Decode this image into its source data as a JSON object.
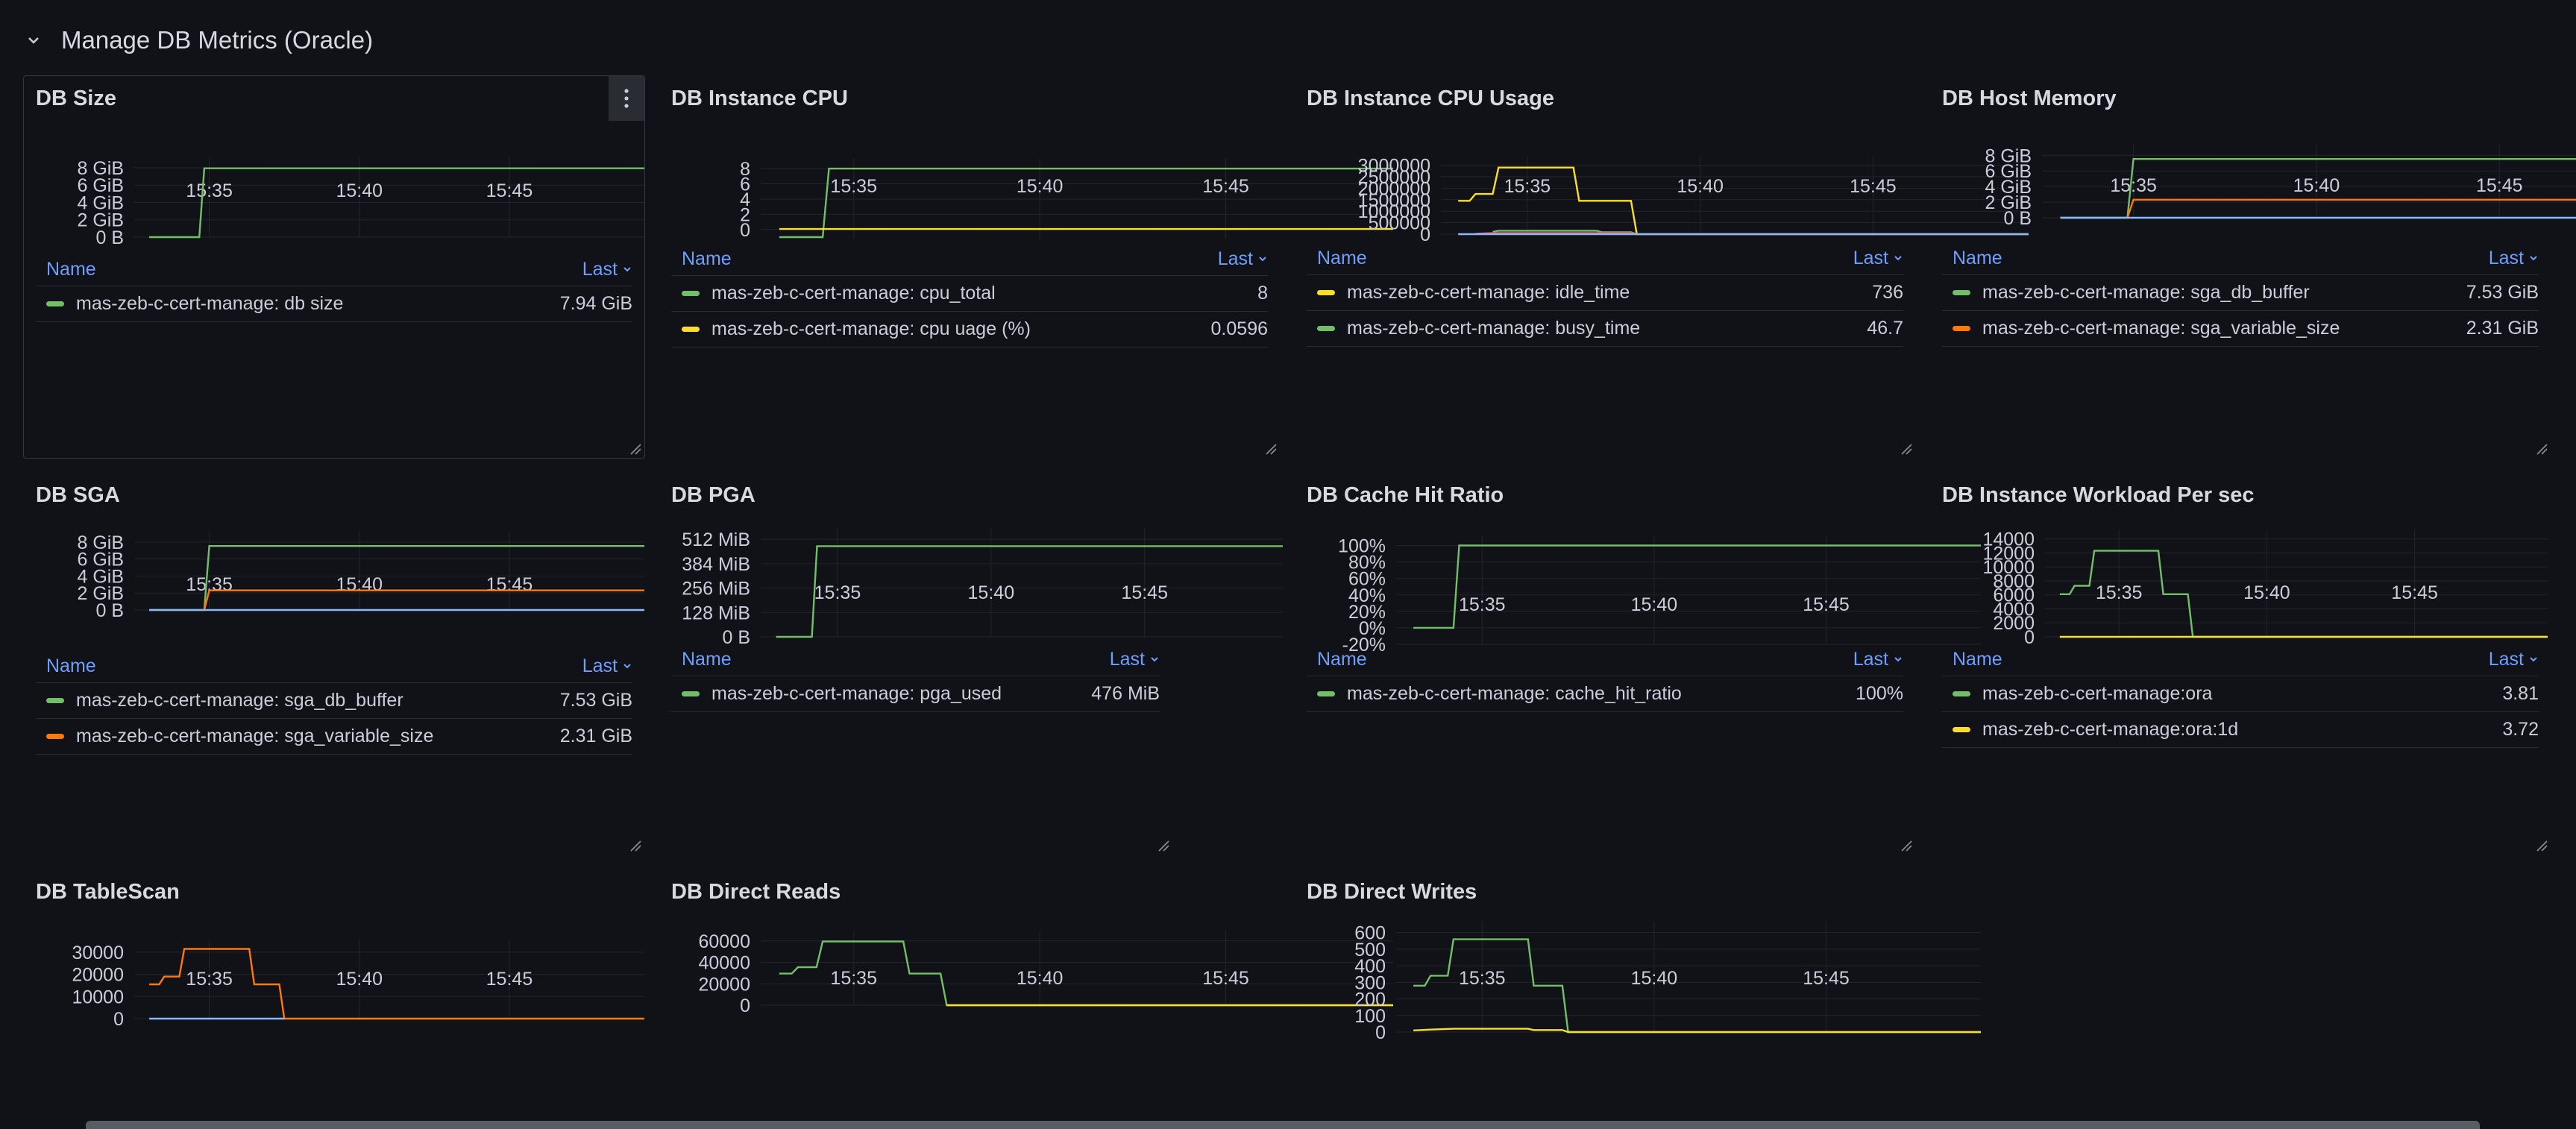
{
  "row": {
    "title": "Manage DB Metrics (Oracle)"
  },
  "colors": {
    "green": "#73bf69",
    "yellow": "#fade2a",
    "orange": "#ff780a",
    "blue": "#8ab8ff",
    "red": "#f2495c",
    "accent": "#6e9fff",
    "background": "#111217"
  },
  "legend_header": {
    "name": "Name",
    "last": "Last"
  },
  "panels": [
    {
      "title": "DB Size",
      "legend": [
        {
          "name": "mas-zeb-c-cert-manage: db size",
          "value": "7.94 GiB",
          "color": "#73bf69"
        }
      ],
      "chart_data": {
        "type": "line",
        "title": "DB Size",
        "x_ticks": [
          "15:35",
          "15:40",
          "15:45"
        ],
        "y_ticks": [
          "0 B",
          "2 GiB",
          "4 GiB",
          "6 GiB",
          "8 GiB"
        ],
        "ylim": [
          0,
          8.6
        ],
        "unit": "GiB",
        "series": [
          {
            "name": "mas-zeb-c-cert-manage: db size",
            "color": "#73bf69",
            "points": [
              [
                "15:33",
                "0"
              ],
              [
                "15:34:40",
                "0"
              ],
              [
                "15:34:50",
                "7.94"
              ],
              [
                "15:49:30",
                "7.94"
              ]
            ]
          }
        ]
      }
    },
    {
      "title": "DB Instance CPU",
      "legend": [
        {
          "name": "mas-zeb-c-cert-manage: cpu_total",
          "value": "8",
          "color": "#73bf69"
        },
        {
          "name": "mas-zeb-c-cert-manage: cpu uage (%)",
          "value": "0.0596",
          "color": "#fade2a"
        }
      ],
      "chart_data": {
        "type": "line",
        "title": "DB Instance CPU",
        "x_ticks": [
          "15:35",
          "15:40",
          "15:45"
        ],
        "y_ticks": [
          "0",
          "2",
          "4",
          "6",
          "8"
        ],
        "ylim": [
          -1.2,
          8.6
        ],
        "series": [
          {
            "name": "mas-zeb-c-cert-manage: cpu_total",
            "color": "#73bf69",
            "points": [
              [
                "15:33",
                "-1"
              ],
              [
                "15:34:10",
                "-1"
              ],
              [
                "15:34:20",
                "8"
              ],
              [
                "15:49:30",
                "8"
              ]
            ]
          },
          {
            "name": "mas-zeb-c-cert-manage: cpu uage (%)",
            "color": "#fade2a",
            "points": [
              [
                "15:33",
                "0.06"
              ],
              [
                "15:49:30",
                "0.06"
              ]
            ]
          }
        ]
      }
    },
    {
      "title": "DB Instance CPU Usage",
      "legend": [
        {
          "name": "mas-zeb-c-cert-manage: idle_time",
          "value": "736",
          "color": "#fade2a"
        },
        {
          "name": "mas-zeb-c-cert-manage: busy_time",
          "value": "46.7",
          "color": "#73bf69"
        }
      ],
      "chart_data": {
        "type": "line",
        "title": "DB Instance CPU Usage",
        "x_ticks": [
          "15:35",
          "15:40",
          "15:45"
        ],
        "y_ticks": [
          "0",
          "500000",
          "1000000",
          "1500000",
          "2000000",
          "2500000",
          "3000000"
        ],
        "ylim": [
          0,
          3150000
        ],
        "series": [
          {
            "name": "mas-zeb-c-cert-manage: idle_time",
            "color": "#fade2a",
            "points": [
              [
                "15:33",
                "1450000"
              ],
              [
                "15:33:20",
                "1450000"
              ],
              [
                "15:33:30",
                "1750000"
              ],
              [
                "15:34",
                "1750000"
              ],
              [
                "15:34:10",
                "2900000"
              ],
              [
                "15:36:20",
                "2900000"
              ],
              [
                "15:36:30",
                "1450000"
              ],
              [
                "15:38",
                "1450000"
              ],
              [
                "15:38:10",
                "736"
              ],
              [
                "15:49:30",
                "736"
              ]
            ]
          },
          {
            "name": "mas-zeb-c-cert-manage: busy_time",
            "color": "#73bf69",
            "points": [
              [
                "15:34",
                "100000"
              ],
              [
                "15:34:10",
                "150000"
              ],
              [
                "15:37",
                "150000"
              ],
              [
                "15:37:10",
                "80000"
              ],
              [
                "15:38",
                "80000"
              ],
              [
                "15:38:10",
                "47"
              ]
            ]
          },
          {
            "name": "",
            "color": "#f2495c",
            "points": [
              [
                "15:33:30",
                "20000"
              ],
              [
                "15:34",
                "50000"
              ],
              [
                "15:38",
                "50000"
              ],
              [
                "15:38:10",
                "0"
              ]
            ]
          },
          {
            "name": "",
            "color": "#8ab8ff",
            "points": [
              [
                "15:33",
                "0"
              ],
              [
                "15:49:30",
                "0"
              ]
            ]
          }
        ]
      }
    },
    {
      "title": "DB Host Memory",
      "legend": [
        {
          "name": "mas-zeb-c-cert-manage: sga_db_buffer",
          "value": "7.53 GiB",
          "color": "#73bf69"
        },
        {
          "name": "mas-zeb-c-cert-manage: sga_variable_size",
          "value": "2.31 GiB",
          "color": "#ff780a"
        }
      ],
      "chart_data": {
        "type": "line",
        "title": "DB Host Memory",
        "x_ticks": [
          "15:35",
          "15:40",
          "15:45"
        ],
        "y_ticks": [
          "0 B",
          "2 GiB",
          "4 GiB",
          "6 GiB",
          "8 GiB"
        ],
        "ylim": [
          0,
          8.6
        ],
        "unit": "GiB",
        "series": [
          {
            "name": "mas-zeb-c-cert-manage: sga_db_buffer",
            "color": "#73bf69",
            "points": [
              [
                "15:33",
                "0"
              ],
              [
                "15:34:50",
                "0"
              ],
              [
                "15:35:00",
                "7.53"
              ],
              [
                "15:49:30",
                "7.53"
              ]
            ]
          },
          {
            "name": "mas-zeb-c-cert-manage: sga_variable_size",
            "color": "#ff780a",
            "points": [
              [
                "15:34:50",
                "0"
              ],
              [
                "15:35:00",
                "2.31"
              ],
              [
                "15:49:30",
                "2.31"
              ]
            ]
          },
          {
            "name": "",
            "color": "#8ab8ff",
            "points": [
              [
                "15:33",
                "0"
              ],
              [
                "15:49:30",
                "0"
              ]
            ]
          }
        ]
      }
    },
    {
      "title": "DB SGA",
      "legend": [
        {
          "name": "mas-zeb-c-cert-manage: sga_db_buffer",
          "value": "7.53 GiB",
          "color": "#73bf69"
        },
        {
          "name": "mas-zeb-c-cert-manage: sga_variable_size",
          "value": "2.31 GiB",
          "color": "#ff780a"
        }
      ],
      "chart_data": {
        "type": "line",
        "title": "DB SGA",
        "x_ticks": [
          "15:35",
          "15:40",
          "15:45"
        ],
        "y_ticks": [
          "0 B",
          "2 GiB",
          "4 GiB",
          "6 GiB",
          "8 GiB"
        ],
        "ylim": [
          0,
          8.6
        ],
        "unit": "GiB",
        "series": [
          {
            "name": "mas-zeb-c-cert-manage: sga_db_buffer",
            "color": "#73bf69",
            "points": [
              [
                "15:33",
                "0"
              ],
              [
                "15:34:50",
                "0"
              ],
              [
                "15:35:00",
                "7.53"
              ],
              [
                "15:49:30",
                "7.53"
              ]
            ]
          },
          {
            "name": "mas-zeb-c-cert-manage: sga_variable_size",
            "color": "#ff780a",
            "points": [
              [
                "15:34:50",
                "0"
              ],
              [
                "15:35:00",
                "2.31"
              ],
              [
                "15:49:30",
                "2.31"
              ]
            ]
          },
          {
            "name": "",
            "color": "#8ab8ff",
            "points": [
              [
                "15:33",
                "0"
              ],
              [
                "15:49:30",
                "0"
              ]
            ]
          }
        ]
      }
    },
    {
      "title": "DB PGA",
      "legend": [
        {
          "name": "mas-zeb-c-cert-manage: pga_used",
          "value": "476 MiB",
          "color": "#73bf69"
        }
      ],
      "chart_data": {
        "type": "line",
        "title": "DB PGA",
        "x_ticks": [
          "15:35",
          "15:40",
          "15:45"
        ],
        "y_ticks": [
          "0 B",
          "128 MiB",
          "256 MiB",
          "384 MiB",
          "512 MiB"
        ],
        "ylim": [
          0,
          540
        ],
        "unit": "MiB",
        "series": [
          {
            "name": "mas-zeb-c-cert-manage: pga_used",
            "color": "#73bf69",
            "points": [
              [
                "15:33",
                "0"
              ],
              [
                "15:34:10",
                "0"
              ],
              [
                "15:34:20",
                "476"
              ],
              [
                "15:49:30",
                "476"
              ]
            ]
          }
        ]
      }
    },
    {
      "title": "DB Cache Hit Ratio",
      "legend": [
        {
          "name": "mas-zeb-c-cert-manage: cache_hit_ratio",
          "value": "100%",
          "color": "#73bf69"
        }
      ],
      "chart_data": {
        "type": "line",
        "title": "DB Cache Hit Ratio",
        "x_ticks": [
          "15:35",
          "15:40",
          "15:45"
        ],
        "y_ticks": [
          "-20%",
          "0%",
          "20%",
          "40%",
          "60%",
          "80%",
          "100%"
        ],
        "ylim": [
          -20,
          105
        ],
        "unit": "%",
        "series": [
          {
            "name": "mas-zeb-c-cert-manage: cache_hit_ratio",
            "color": "#73bf69",
            "points": [
              [
                "15:33",
                "0"
              ],
              [
                "15:34:10",
                "0"
              ],
              [
                "15:34:20",
                "100"
              ],
              [
                "15:49:30",
                "100"
              ]
            ]
          }
        ]
      }
    },
    {
      "title": "DB Instance Workload Per sec",
      "legend": [
        {
          "name": "mas-zeb-c-cert-manage:ora",
          "value": "3.81",
          "color": "#73bf69"
        },
        {
          "name": "mas-zeb-c-cert-manage:ora:1d",
          "value": "3.72",
          "color": "#fade2a"
        }
      ],
      "chart_data": {
        "type": "line",
        "title": "DB Instance Workload Per sec",
        "x_ticks": [
          "15:35",
          "15:40",
          "15:45"
        ],
        "y_ticks": [
          "0",
          "2000",
          "4000",
          "6000",
          "8000",
          "10000",
          "12000",
          "14000"
        ],
        "ylim": [
          0,
          14500
        ],
        "series": [
          {
            "name": "mas-zeb-c-cert-manage:ora",
            "color": "#73bf69",
            "points": [
              [
                "15:33",
                "6100"
              ],
              [
                "15:33:20",
                "6100"
              ],
              [
                "15:33:30",
                "7300"
              ],
              [
                "15:34",
                "7300"
              ],
              [
                "15:34:10",
                "12300"
              ],
              [
                "15:36:20",
                "12300"
              ],
              [
                "15:36:30",
                "6100"
              ],
              [
                "15:37:20",
                "6100"
              ],
              [
                "15:37:30",
                "3.81"
              ],
              [
                "15:49:30",
                "3.81"
              ]
            ]
          },
          {
            "name": "mas-zeb-c-cert-manage:ora:1d",
            "color": "#fade2a",
            "points": [
              [
                "15:33",
                "3.72"
              ],
              [
                "15:49:30",
                "3.72"
              ]
            ]
          }
        ]
      }
    },
    {
      "title": "DB TableScan",
      "legend": [],
      "chart_data": {
        "type": "line",
        "title": "DB TableScan",
        "x_ticks": [
          "15:35",
          "15:40",
          "15:45"
        ],
        "y_ticks": [
          "0",
          "10000",
          "20000",
          "30000"
        ],
        "ylim": [
          0,
          33000
        ],
        "series": [
          {
            "name": "",
            "color": "#ff780a",
            "points": [
              [
                "15:33",
                "15500"
              ],
              [
                "15:33:20",
                "15500"
              ],
              [
                "15:33:30",
                "19000"
              ],
              [
                "15:34",
                "19000"
              ],
              [
                "15:34:10",
                "31500"
              ],
              [
                "15:36:20",
                "31500"
              ],
              [
                "15:36:30",
                "15500"
              ],
              [
                "15:37:20",
                "15500"
              ],
              [
                "15:37:30",
                "0"
              ],
              [
                "15:49:30",
                "0"
              ]
            ]
          },
          {
            "name": "",
            "color": "#8ab8ff",
            "points": [
              [
                "15:33",
                "0"
              ],
              [
                "15:37:30",
                "0"
              ]
            ]
          }
        ]
      }
    },
    {
      "title": "DB Direct Reads",
      "legend": [],
      "chart_data": {
        "type": "line",
        "title": "DB Direct Reads",
        "x_ticks": [
          "15:35",
          "15:40",
          "15:45"
        ],
        "y_ticks": [
          "0",
          "20000",
          "40000",
          "60000"
        ],
        "ylim": [
          0,
          64000
        ],
        "series": [
          {
            "name": "",
            "color": "#73bf69",
            "points": [
              [
                "15:33",
                "29500"
              ],
              [
                "15:33:20",
                "29500"
              ],
              [
                "15:33:30",
                "35500"
              ],
              [
                "15:34",
                "35500"
              ],
              [
                "15:34:10",
                "59500"
              ],
              [
                "15:36:20",
                "59500"
              ],
              [
                "15:36:30",
                "29500"
              ],
              [
                "15:37:20",
                "29500"
              ],
              [
                "15:37:30",
                "0"
              ],
              [
                "15:49:30",
                "0"
              ]
            ]
          },
          {
            "name": "",
            "color": "#fade2a",
            "points": [
              [
                "15:37:30",
                "0"
              ],
              [
                "15:49:30",
                "0"
              ]
            ]
          }
        ]
      }
    },
    {
      "title": "DB Direct Writes",
      "legend": [],
      "chart_data": {
        "type": "line",
        "title": "DB Direct Writes",
        "x_ticks": [
          "15:35",
          "15:40",
          "15:45"
        ],
        "y_ticks": [
          "0",
          "100",
          "200",
          "300",
          "400",
          "500",
          "600"
        ],
        "ylim": [
          0,
          630
        ],
        "series": [
          {
            "name": "",
            "color": "#73bf69",
            "points": [
              [
                "15:33",
                "280"
              ],
              [
                "15:33:20",
                "280"
              ],
              [
                "15:33:30",
                "340"
              ],
              [
                "15:34",
                "340"
              ],
              [
                "15:34:10",
                "560"
              ],
              [
                "15:36:20",
                "560"
              ],
              [
                "15:36:30",
                "280"
              ],
              [
                "15:37:20",
                "280"
              ],
              [
                "15:37:30",
                "0"
              ],
              [
                "15:49:30",
                "0"
              ]
            ]
          },
          {
            "name": "",
            "color": "#fade2a",
            "points": [
              [
                "15:33",
                "10"
              ],
              [
                "15:33:30",
                "15"
              ],
              [
                "15:34:10",
                "20"
              ],
              [
                "15:36:20",
                "20"
              ],
              [
                "15:36:30",
                "12"
              ],
              [
                "15:37:20",
                "12"
              ],
              [
                "15:37:30",
                "0"
              ],
              [
                "15:49:30",
                "0"
              ]
            ]
          }
        ]
      }
    }
  ]
}
